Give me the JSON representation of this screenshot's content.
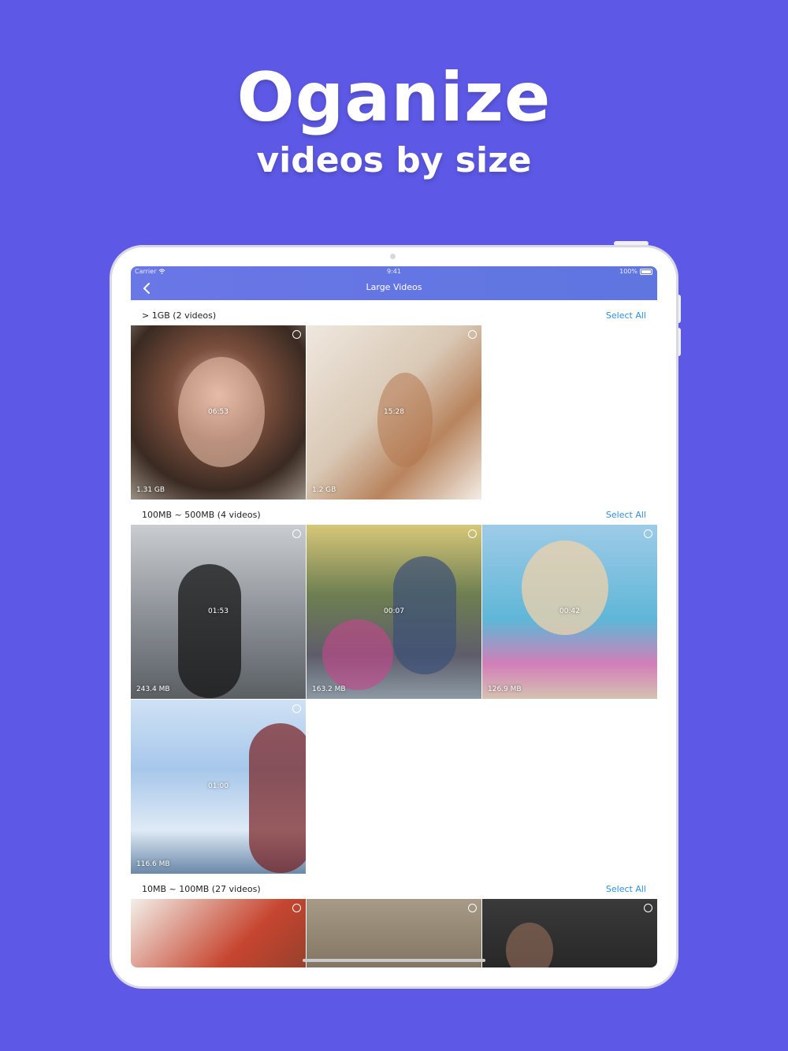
{
  "promo": {
    "headline": "Oganize",
    "subheadline": "videos by size"
  },
  "status_bar": {
    "carrier": "Carrier",
    "time": "9:41",
    "battery": "100%"
  },
  "navbar": {
    "title": "Large Videos",
    "back_icon": "chevron-left-icon"
  },
  "sections": [
    {
      "title": "> 1GB (2 videos)",
      "select_all": "Select All",
      "videos": [
        {
          "duration": "06:53",
          "size": "1.31 GB"
        },
        {
          "duration": "15:28",
          "size": "1.2 GB"
        }
      ]
    },
    {
      "title": "100MB ~ 500MB (4 videos)",
      "select_all": "Select All",
      "videos": [
        {
          "duration": "01:53",
          "size": "243.4 MB"
        },
        {
          "duration": "00:07",
          "size": "163.2 MB"
        },
        {
          "duration": "00:42",
          "size": "126.9 MB"
        },
        {
          "duration": "01:00",
          "size": "116.6 MB"
        }
      ]
    },
    {
      "title": "10MB ~ 100MB (27 videos)",
      "select_all": "Select All",
      "videos": [
        {
          "duration": "",
          "size": ""
        },
        {
          "duration": "",
          "size": ""
        },
        {
          "duration": "",
          "size": ""
        }
      ]
    }
  ],
  "colors": {
    "background": "#5d59e6",
    "navbar": "#6a77e6",
    "select_all": "#2f8fe6"
  }
}
